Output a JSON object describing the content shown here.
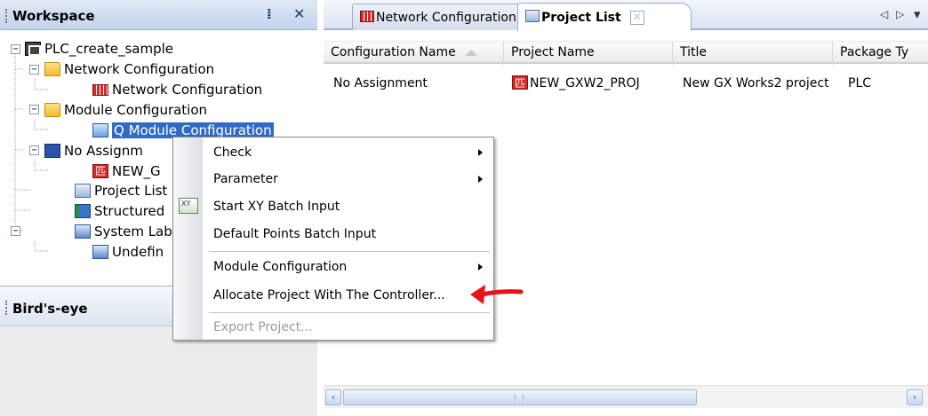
{
  "workspace": {
    "title": "Workspace",
    "pin_icon": "pin-icon",
    "close_icon": "close-icon",
    "tree": [
      {
        "label": "PLC_create_sample",
        "icon": "plc-icon"
      },
      {
        "label": "Network Configuration",
        "icon": "folder-icon"
      },
      {
        "label": "Network Configuration",
        "icon": "network-icon"
      },
      {
        "label": "Module Configuration",
        "icon": "folder-icon"
      },
      {
        "label": "Q Module Configuration",
        "icon": "module-icon"
      },
      {
        "label": "No Assignm",
        "icon": "no-assignment-icon"
      },
      {
        "label": "NEW_G",
        "icon": "project-icon"
      },
      {
        "label": "Project List",
        "icon": "project-list-icon"
      },
      {
        "label": "Structured",
        "icon": "structured-icon"
      },
      {
        "label": "System Lab",
        "icon": "system-label-icon"
      },
      {
        "label": "Undefin",
        "icon": "undefined-icon"
      }
    ]
  },
  "birdseye": {
    "title": "Bird's-eye"
  },
  "tabs": [
    {
      "label": "Network Configuration",
      "icon": "network-icon"
    },
    {
      "label": "Project List",
      "icon": "project-list-icon",
      "close": "✕"
    }
  ],
  "tab_nav": {
    "prev": "◁",
    "next": "▷",
    "menu": "▾"
  },
  "grid": {
    "columns": [
      "Configuration Name",
      "Project Name",
      "Title",
      "Package Ty"
    ],
    "rows": [
      [
        "No Assignment",
        "NEW_GXW2_PROJ",
        "New GX Works2 project",
        "PLC"
      ]
    ]
  },
  "scroll": {
    "left": "‹",
    "right": "›"
  },
  "context_menu": {
    "items": [
      {
        "label": "Check",
        "submenu": true
      },
      {
        "label": "Parameter",
        "submenu": true
      },
      {
        "label": "Start XY Batch Input",
        "icon": "xy-batch-input-icon"
      },
      {
        "label": "Default Points Batch Input"
      },
      {
        "label": "Module Configuration",
        "submenu": true
      },
      {
        "label": "Allocate Project With The Controller..."
      },
      {
        "label": "Export Project...",
        "disabled": true
      }
    ]
  },
  "annotation": {
    "color": "#e8121a",
    "icon": "red-arrow-icon"
  }
}
